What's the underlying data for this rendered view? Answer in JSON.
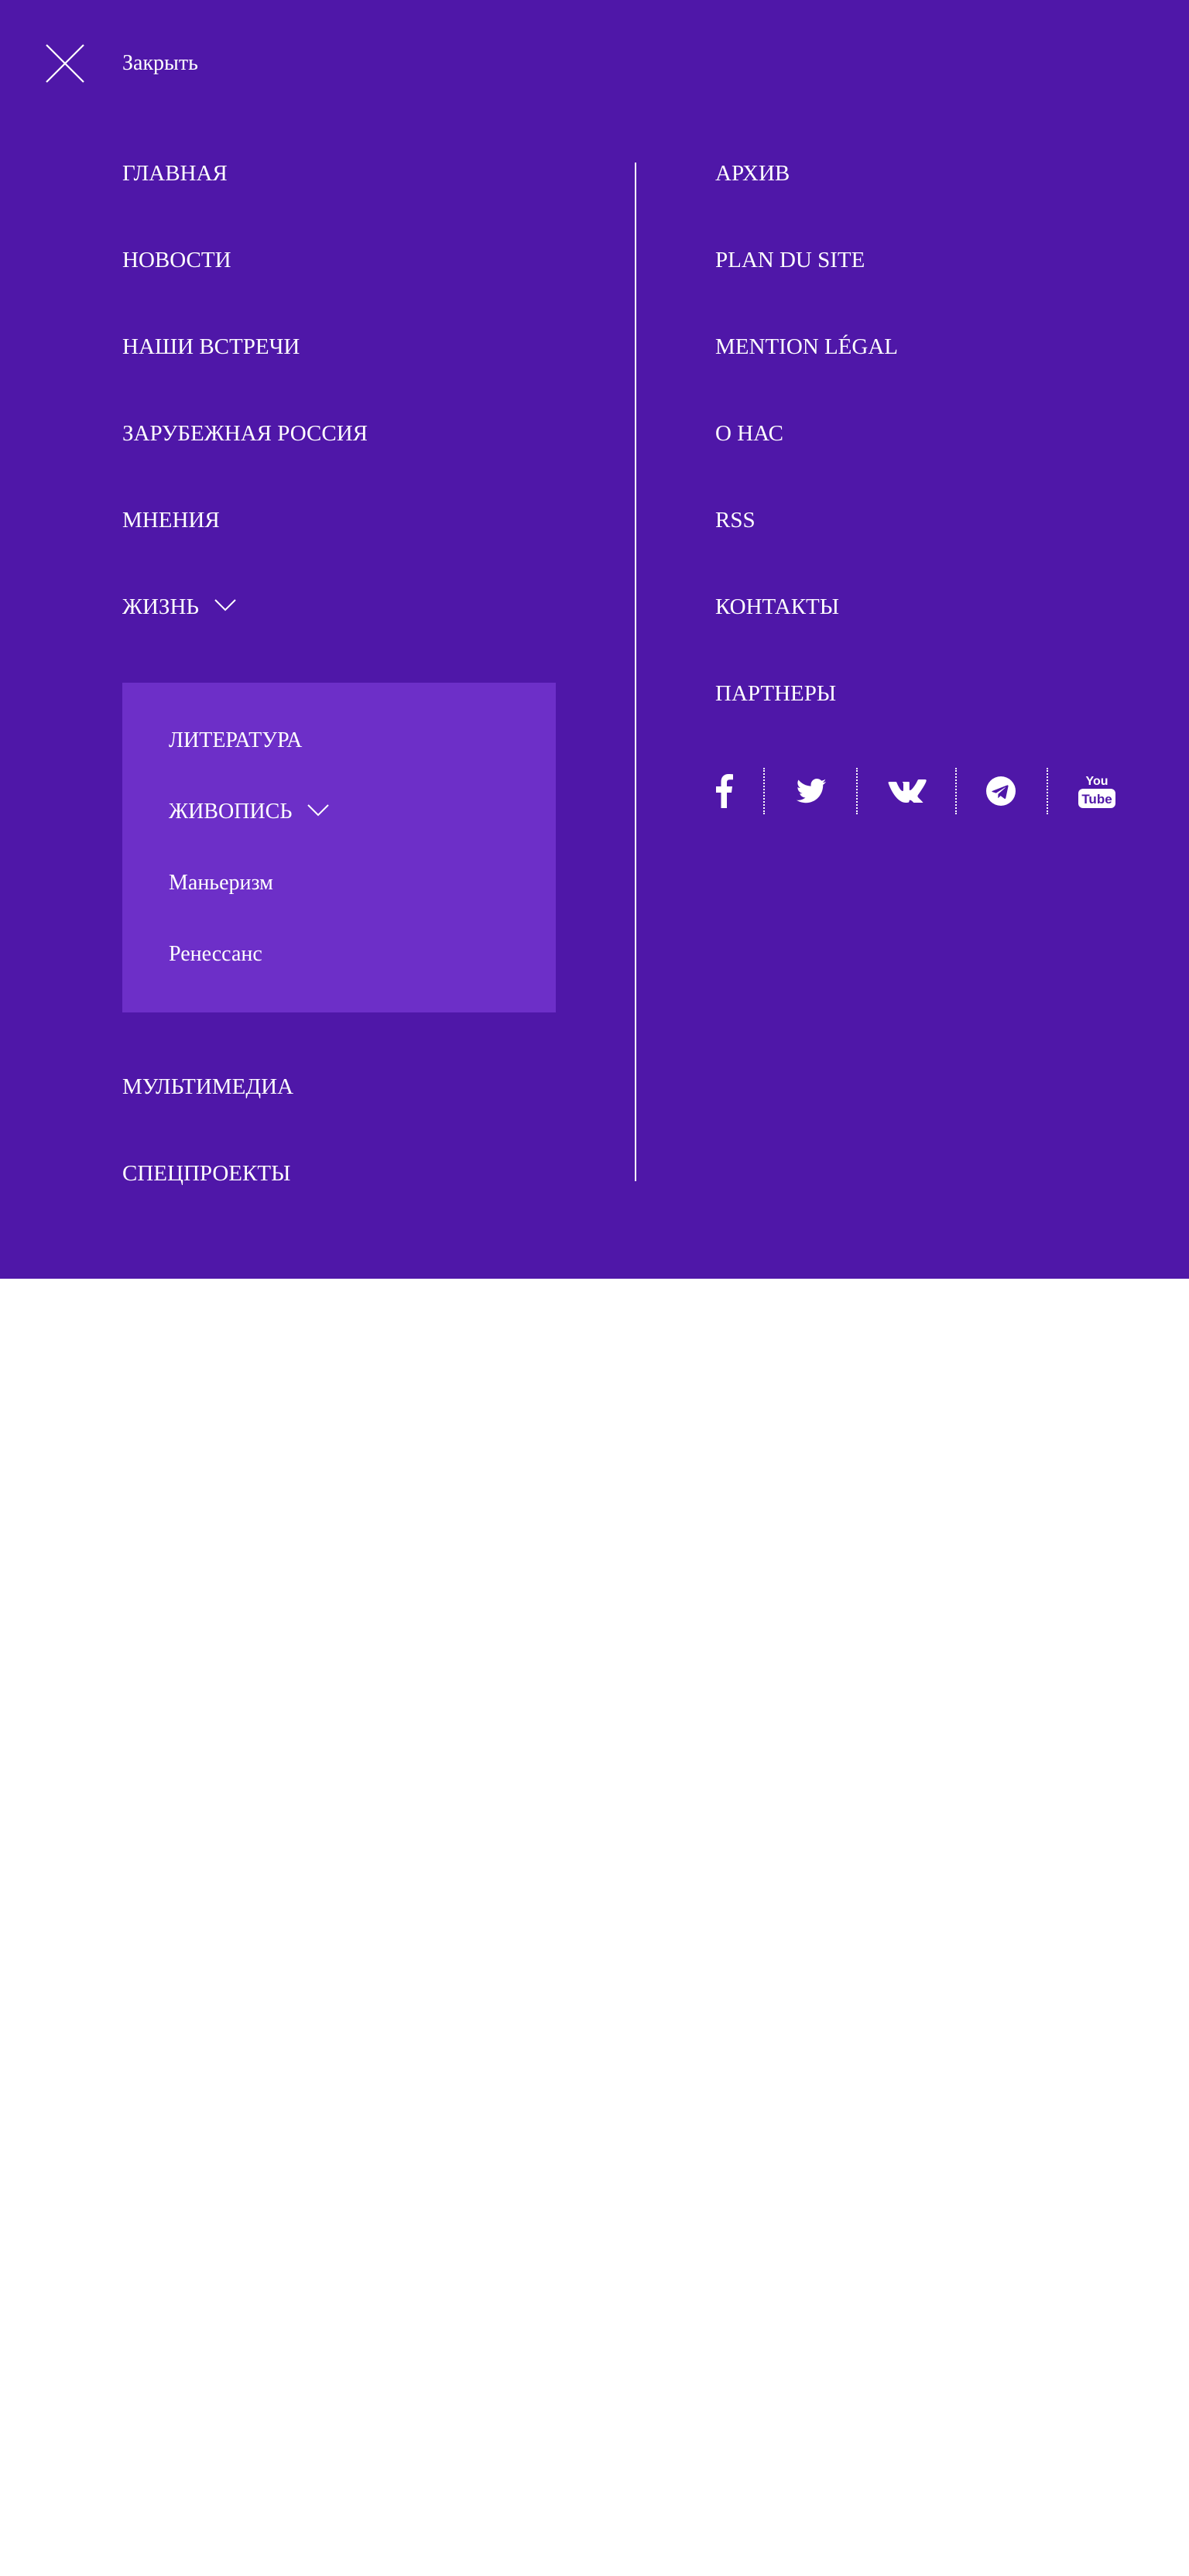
{
  "close": {
    "label": "Закрыть",
    "icon": "close-icon"
  },
  "left_nav": {
    "home": "ГЛАВНАЯ",
    "news": "НОВОСТИ",
    "meetings": "НАШИ ВСТРЕЧИ",
    "russia_abroad": "ЗАРУБЕЖНАЯ РОССИЯ",
    "opinions": "МНЕНИЯ",
    "life": "ЖИЗНЬ",
    "multimedia": "МУЛЬТИМЕДИА",
    "special": "СПЕЦПРОЕКТЫ"
  },
  "submenu": {
    "literature": "ЛИТЕРАТУРА",
    "painting": "ЖИВОПИСЬ",
    "mannerism": "Маньеризм",
    "renaissance": "Ренессанс"
  },
  "right_nav": {
    "archive": "АРХИВ",
    "sitemap": "PLAN DU SITE",
    "legal": "MENTION LÉGAL",
    "about": "О НАС",
    "rss": "RSS",
    "contacts": "КОНТАКТЫ",
    "partners": "ПАРТНЕРЫ"
  },
  "social": {
    "icons": [
      "facebook-icon",
      "twitter-icon",
      "vk-icon",
      "telegram-icon",
      "youtube-icon"
    ],
    "youtube_text_top": "You",
    "youtube_text_bottom": "Tube"
  },
  "colors": {
    "panel_bg": "#4f17a8",
    "submenu_bg": "#6d2fc8",
    "text": "#ffffff",
    "page_bg": "#ffffff"
  }
}
